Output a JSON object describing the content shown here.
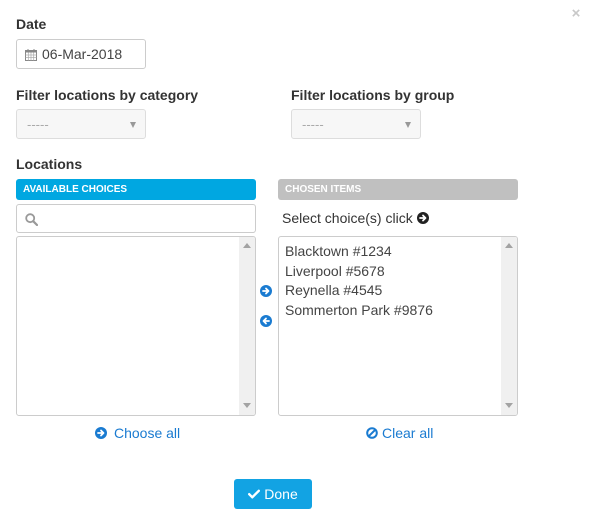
{
  "dialog": {
    "close_icon": "×"
  },
  "date": {
    "label": "Date",
    "value": "06-Mar-2018",
    "icon": "calendar-icon"
  },
  "filters": {
    "category": {
      "label": "Filter locations by category",
      "selected": "-----"
    },
    "group": {
      "label": "Filter locations by group",
      "selected": "-----"
    }
  },
  "locations": {
    "label": "Locations",
    "available": {
      "header": "Available choices",
      "search_placeholder": "",
      "search_value": "",
      "items": [],
      "choose_all_label": "Choose all"
    },
    "chosen": {
      "header": "Chosen items",
      "hint": "Select choice(s) click",
      "items": [
        "Blacktown #1234",
        "Liverpool #5678",
        "Reynella #4545",
        "Sommerton Park #9876"
      ],
      "clear_all_label": "Clear all"
    }
  },
  "actions": {
    "done_label": "Done"
  },
  "colors": {
    "accent": "#00a7e1",
    "button": "#12a3e3",
    "link": "#1a7bd1",
    "chosen_header": "#c0c0c0"
  }
}
